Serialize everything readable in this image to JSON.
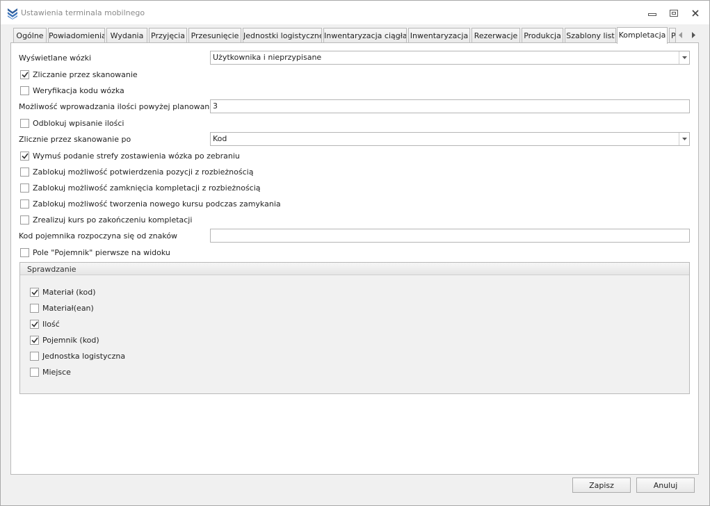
{
  "window": {
    "title": "Ustawienia terminala mobilnego",
    "minimize_icon": "minimize-icon",
    "maximize_icon": "maximize-icon",
    "close_icon": "close-icon"
  },
  "tabs": [
    {
      "label": "Ogólne"
    },
    {
      "label": "Powiadomienia"
    },
    {
      "label": "Wydania"
    },
    {
      "label": "Przyjęcia"
    },
    {
      "label": "Przesunięcie"
    },
    {
      "label": "Jednostki logistyczne"
    },
    {
      "label": "Inwentaryzacja ciągła"
    },
    {
      "label": "Inwentaryzacja"
    },
    {
      "label": "Rezerwacje"
    },
    {
      "label": "Produkcja"
    },
    {
      "label": "Szablony list"
    },
    {
      "label": "Kompletacja",
      "active": true
    },
    {
      "label": "P"
    }
  ],
  "form": {
    "carts_label": "Wyświetlane wózki",
    "carts_value": "Użytkownika i nieprzypisane",
    "count_by_scan": {
      "label": "Zliczanie przez skanowanie",
      "checked": true
    },
    "verify_cart_code": {
      "label": "Weryfikacja kodu wózka",
      "checked": false
    },
    "over_qty_label": "Możliwość wprowadzania ilości powyżej planowanej ilości",
    "over_qty_value": "3",
    "unlock_qty": {
      "label": "Odblokuj wpisanie ilości",
      "checked": false
    },
    "count_by_label": "Zlicznie przez skanowanie po",
    "count_by_value": "Kod",
    "force_zone": {
      "label": "Wymuś podanie strefy zostawienia wózka po zebraniu",
      "checked": true
    },
    "block_confirm": {
      "label": "Zablokuj możliwość potwierdzenia pozycji z rozbieżnością",
      "checked": false
    },
    "block_close": {
      "label": "Zablokuj możliwość zamknięcia kompletacji z rozbieżnością",
      "checked": false
    },
    "block_new_course": {
      "label": "Zablokuj możliwość tworzenia nowego kursu podczas zamykania",
      "checked": false
    },
    "complete_course": {
      "label": "Zrealizuj kurs po zakończeniu kompletacji",
      "checked": false
    },
    "container_prefix_label": "Kod pojemnika rozpoczyna się od znaków",
    "container_prefix_value": "",
    "container_first": {
      "label": "Pole \"Pojemnik\" pierwsze na widoku",
      "checked": false
    }
  },
  "check_group": {
    "title": "Sprawdzanie",
    "items": [
      {
        "label": "Materiał (kod)",
        "checked": true
      },
      {
        "label": "Materiał(ean)",
        "checked": false
      },
      {
        "label": "Ilość",
        "checked": true
      },
      {
        "label": "Pojemnik (kod)",
        "checked": true
      },
      {
        "label": "Jednostka logistyczna",
        "checked": false
      },
      {
        "label": "Miejsce",
        "checked": false
      }
    ]
  },
  "buttons": {
    "save": "Zapisz",
    "cancel": "Anuluj"
  },
  "colors": {
    "window_bg": "#f0f0f0",
    "panel_bg": "#ffffff",
    "border": "#b9b9b9",
    "title_text": "#8a8a8a",
    "app_icon": "#2f5f9e"
  }
}
